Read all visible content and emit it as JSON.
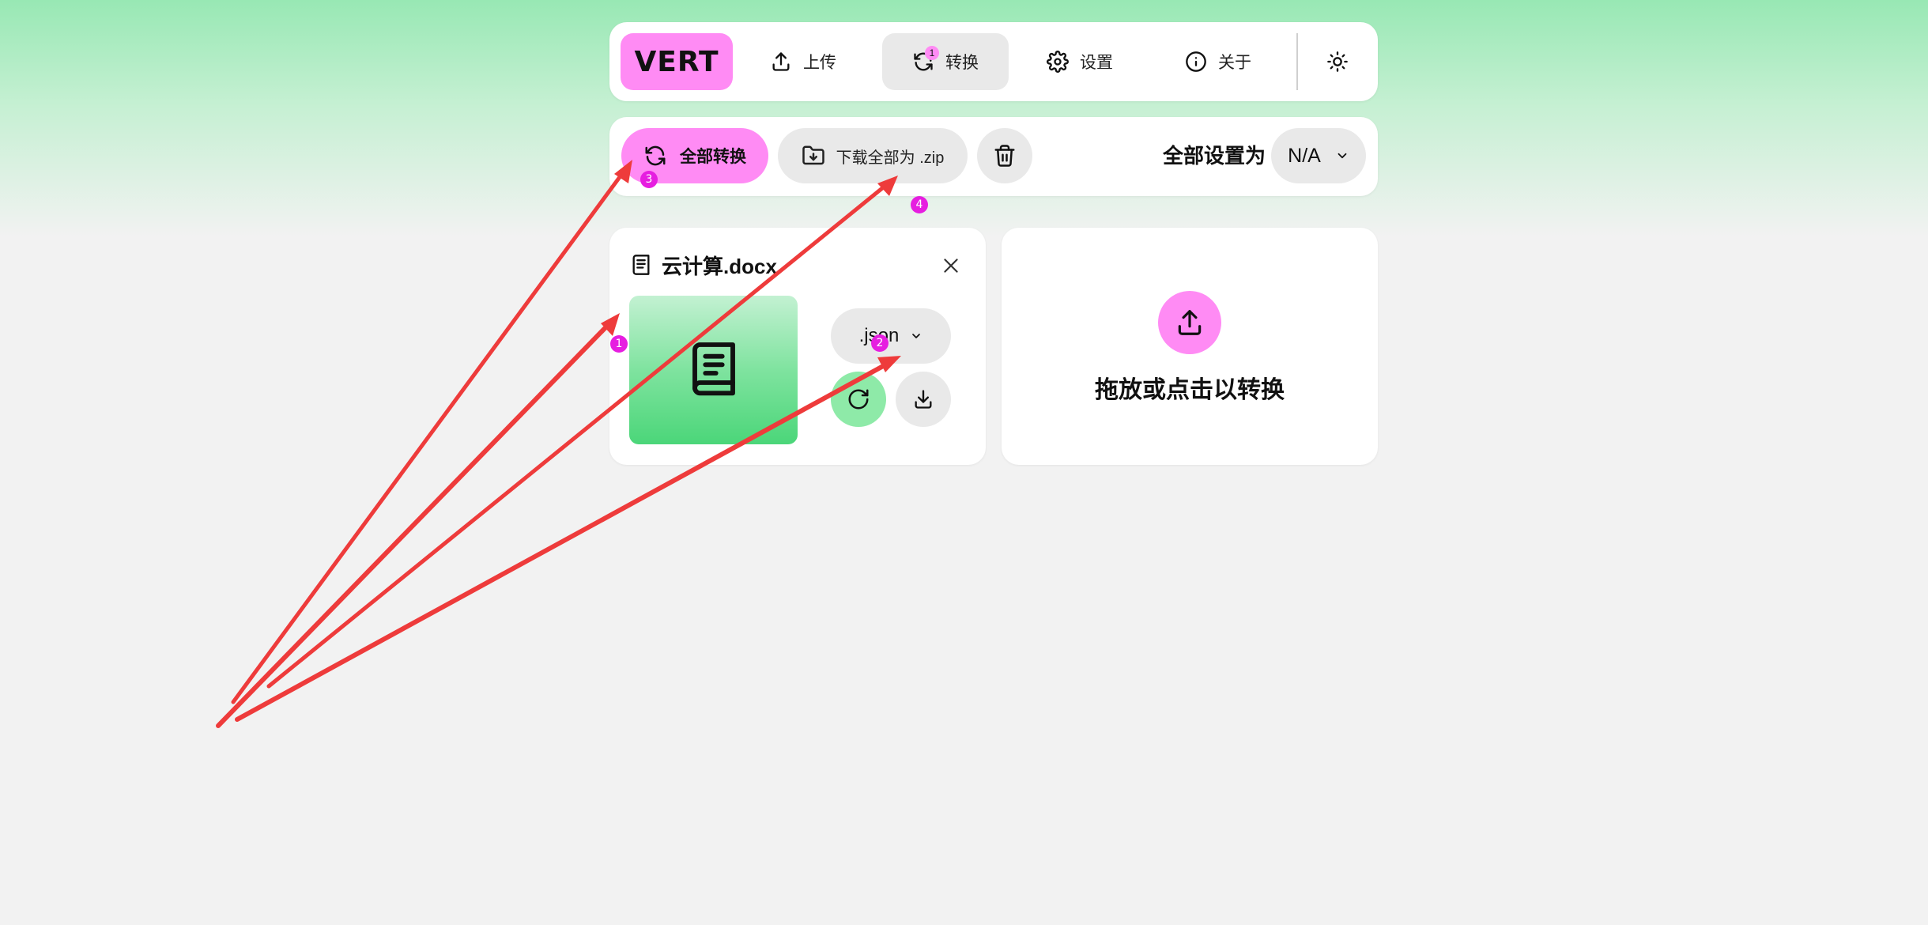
{
  "nav": {
    "logo": "VERT",
    "upload_label": "上传",
    "convert_label": "转换",
    "convert_badge": "1",
    "settings_label": "设置",
    "about_label": "关于"
  },
  "toolbar": {
    "convert_all_label": "全部转换",
    "download_zip_label": "下载全部为 .zip",
    "set_all_label": "全部设置为",
    "set_all_value": "N/A"
  },
  "file": {
    "name": "云计算.docx",
    "target_format": ".json"
  },
  "drop_zone": {
    "text": "拖放或点击以转换"
  },
  "annotations": {
    "badges": [
      "1",
      "2",
      "3",
      "4"
    ]
  },
  "colors": {
    "accent_pink": "#ff8bf4",
    "accent_green": "#8eeaa8",
    "badge_magenta": "#e61ee0",
    "arrow_red": "#ee3b3b"
  }
}
